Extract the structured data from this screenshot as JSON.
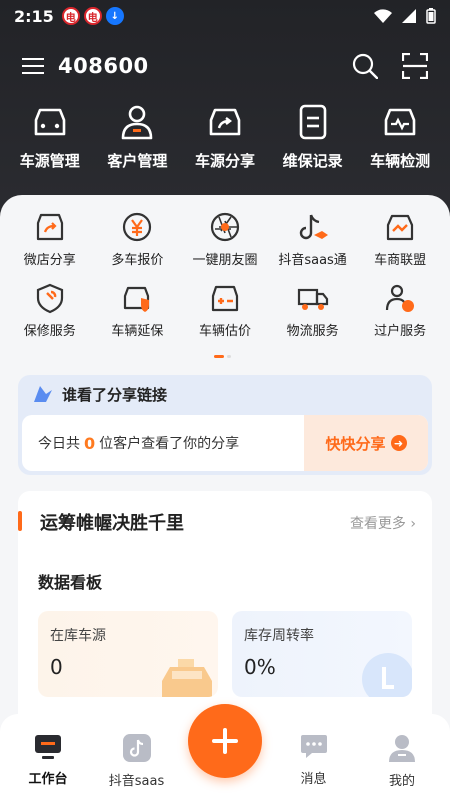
{
  "status": {
    "time": "2:15",
    "badge1": "电",
    "badge2": "电",
    "badge3": "↓"
  },
  "header": {
    "title": "408600"
  },
  "quick": [
    {
      "label": "车源管理",
      "icon": "car-icon"
    },
    {
      "label": "客户管理",
      "icon": "customer-icon"
    },
    {
      "label": "车源分享",
      "icon": "car-share-icon"
    },
    {
      "label": "维保记录",
      "icon": "record-icon"
    },
    {
      "label": "车辆检测",
      "icon": "car-inspect-icon"
    }
  ],
  "grid": [
    {
      "label": "微店分享",
      "icon": "shop-icon"
    },
    {
      "label": "多车报价",
      "icon": "yen-icon"
    },
    {
      "label": "一键朋友圈",
      "icon": "aperture-icon"
    },
    {
      "label": "抖音saas通",
      "icon": "tiktok-icon"
    },
    {
      "label": "车商联盟",
      "icon": "handshake-icon"
    },
    {
      "label": "保修服务",
      "icon": "shield-icon"
    },
    {
      "label": "车辆延保",
      "icon": "car-shield-icon"
    },
    {
      "label": "车辆估价",
      "icon": "valuation-icon"
    },
    {
      "label": "物流服务",
      "icon": "truck-icon"
    },
    {
      "label": "过户服务",
      "icon": "transfer-icon"
    }
  ],
  "share": {
    "title": "谁看了分享链接",
    "prefix": "今日共",
    "count": "0",
    "suffix": "位客户查看了你的分享",
    "button": "快快分享"
  },
  "panel": {
    "title": "运筹帷幄决胜千里",
    "more": "查看更多 ›",
    "board": "数据看板",
    "stats": [
      {
        "label": "在库车源",
        "value": "0"
      },
      {
        "label": "库存周转率",
        "value": "0%"
      }
    ]
  },
  "nav": [
    {
      "label": "工作台",
      "icon": "workbench-icon"
    },
    {
      "label": "抖音saas",
      "icon": "tiktok-icon"
    },
    {
      "label": "消息",
      "icon": "message-icon"
    },
    {
      "label": "我的",
      "icon": "profile-icon"
    }
  ],
  "colors": {
    "accent": "#ff6a1a",
    "dark": "#222327"
  }
}
